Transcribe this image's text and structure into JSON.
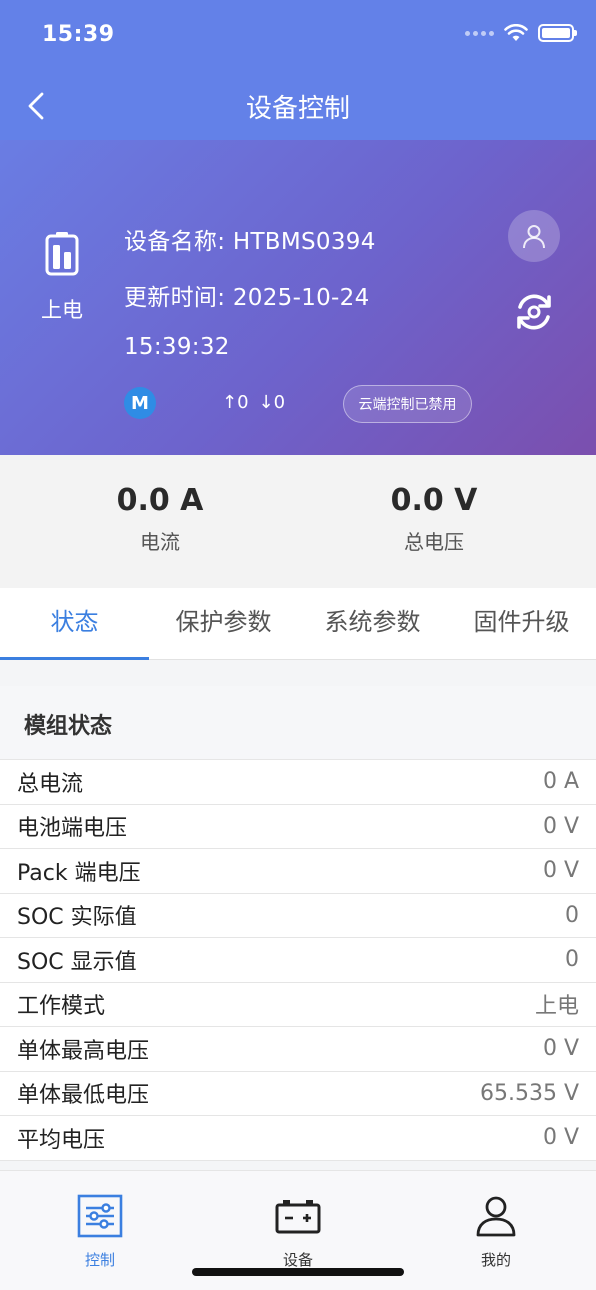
{
  "status_bar": {
    "time": "15:39"
  },
  "nav": {
    "title": "设备控制"
  },
  "device": {
    "power_label": "上电",
    "name_line": "设备名称: HTBMS0394",
    "update_line": "更新时间: 2025-10-24",
    "update_time": "15:39:32",
    "badge_letter": "M",
    "up_count": "↑0",
    "down_count": "↓0",
    "cloud_status": "云端控制已禁用"
  },
  "stats": [
    {
      "value": "0.0 A",
      "label": "电流"
    },
    {
      "value": "0.0 V",
      "label": "总电压"
    }
  ],
  "tabs": [
    {
      "label": "状态",
      "active": true
    },
    {
      "label": "保护参数",
      "active": false
    },
    {
      "label": "系统参数",
      "active": false
    },
    {
      "label": "固件升级",
      "active": false
    }
  ],
  "section": {
    "title": "模组状态",
    "rows": [
      {
        "label": "总电流",
        "value": "0 A"
      },
      {
        "label": "电池端电压",
        "value": "0 V"
      },
      {
        "label": "Pack 端电压",
        "value": "0 V"
      },
      {
        "label": "SOC 实际值",
        "value": "0"
      },
      {
        "label": "SOC 显示值",
        "value": "0"
      },
      {
        "label": "工作模式",
        "value": "上电"
      },
      {
        "label": "单体最高电压",
        "value": "0 V"
      },
      {
        "label": "单体最低电压",
        "value": "65.535 V"
      },
      {
        "label": "平均电压",
        "value": "0 V"
      }
    ]
  },
  "bottom_nav": [
    {
      "label": "控制",
      "active": true
    },
    {
      "label": "设备",
      "active": false
    },
    {
      "label": "我的",
      "active": false
    }
  ],
  "colors": {
    "accent": "#3b7fe0",
    "header": "#6381e8",
    "badge": "#2f8ce5"
  }
}
